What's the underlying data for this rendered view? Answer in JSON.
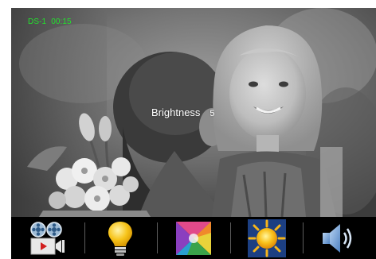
{
  "status": {
    "camera": "DS-1",
    "time": "00:15",
    "color": "#22e12d"
  },
  "osd": {
    "label": "Brightness",
    "value": "5"
  },
  "toolbar": {
    "buttons": [
      {
        "icon": "camera-record-icon",
        "name": "capture-record-button"
      },
      {
        "icon": "lightbulb-icon",
        "name": "light-button"
      },
      {
        "icon": "color-palette-icon",
        "name": "color-button"
      },
      {
        "icon": "sun-brightness-icon",
        "name": "brightness-button"
      },
      {
        "icon": "speaker-volume-icon",
        "name": "volume-button"
      }
    ]
  }
}
